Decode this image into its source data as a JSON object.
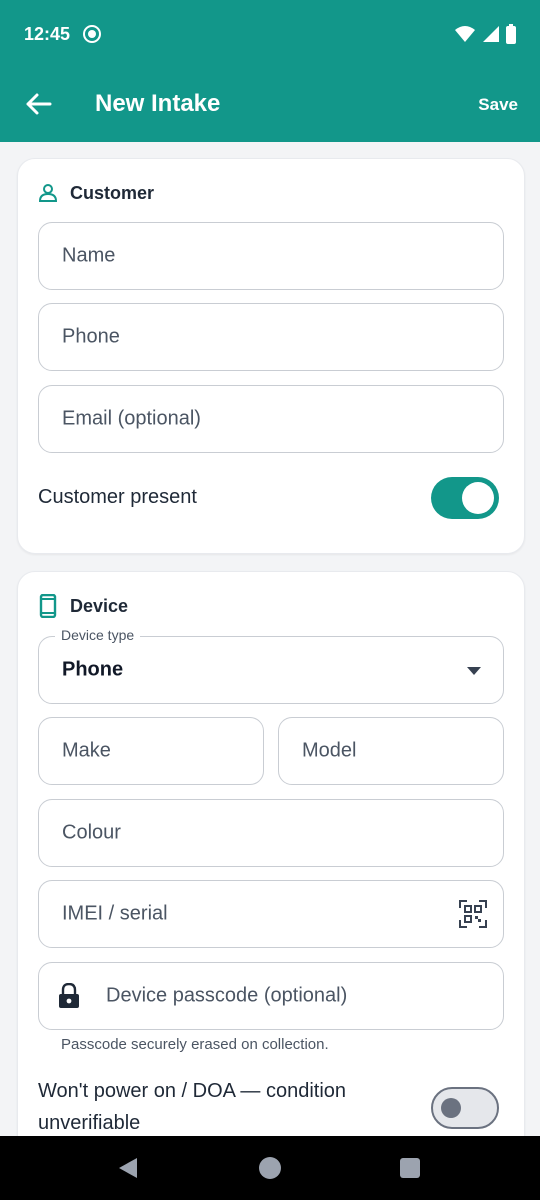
{
  "status": {
    "time": "12:45"
  },
  "app_bar": {
    "title": "New Intake",
    "save_label": "Save"
  },
  "customer": {
    "title": "Customer",
    "name_placeholder": "Name",
    "phone_placeholder": "Phone",
    "email_placeholder": "Email (optional)",
    "present_label": "Customer present",
    "present_on": true
  },
  "device": {
    "title": "Device",
    "device_type_label": "Device type",
    "device_type_value": "Phone",
    "make_placeholder": "Make",
    "model_placeholder": "Model",
    "colour_placeholder": "Colour",
    "imei_placeholder": "IMEI / serial",
    "passcode_placeholder": "Device passcode (optional)",
    "passcode_helper": "Passcode securely erased on collection.",
    "doa_label_line1": "Won't power on / DOA — condition",
    "doa_label_line2": "unverifiable",
    "doa_on": false
  },
  "colors": {
    "accent": "#12978a",
    "background": "#f3f4f6"
  }
}
